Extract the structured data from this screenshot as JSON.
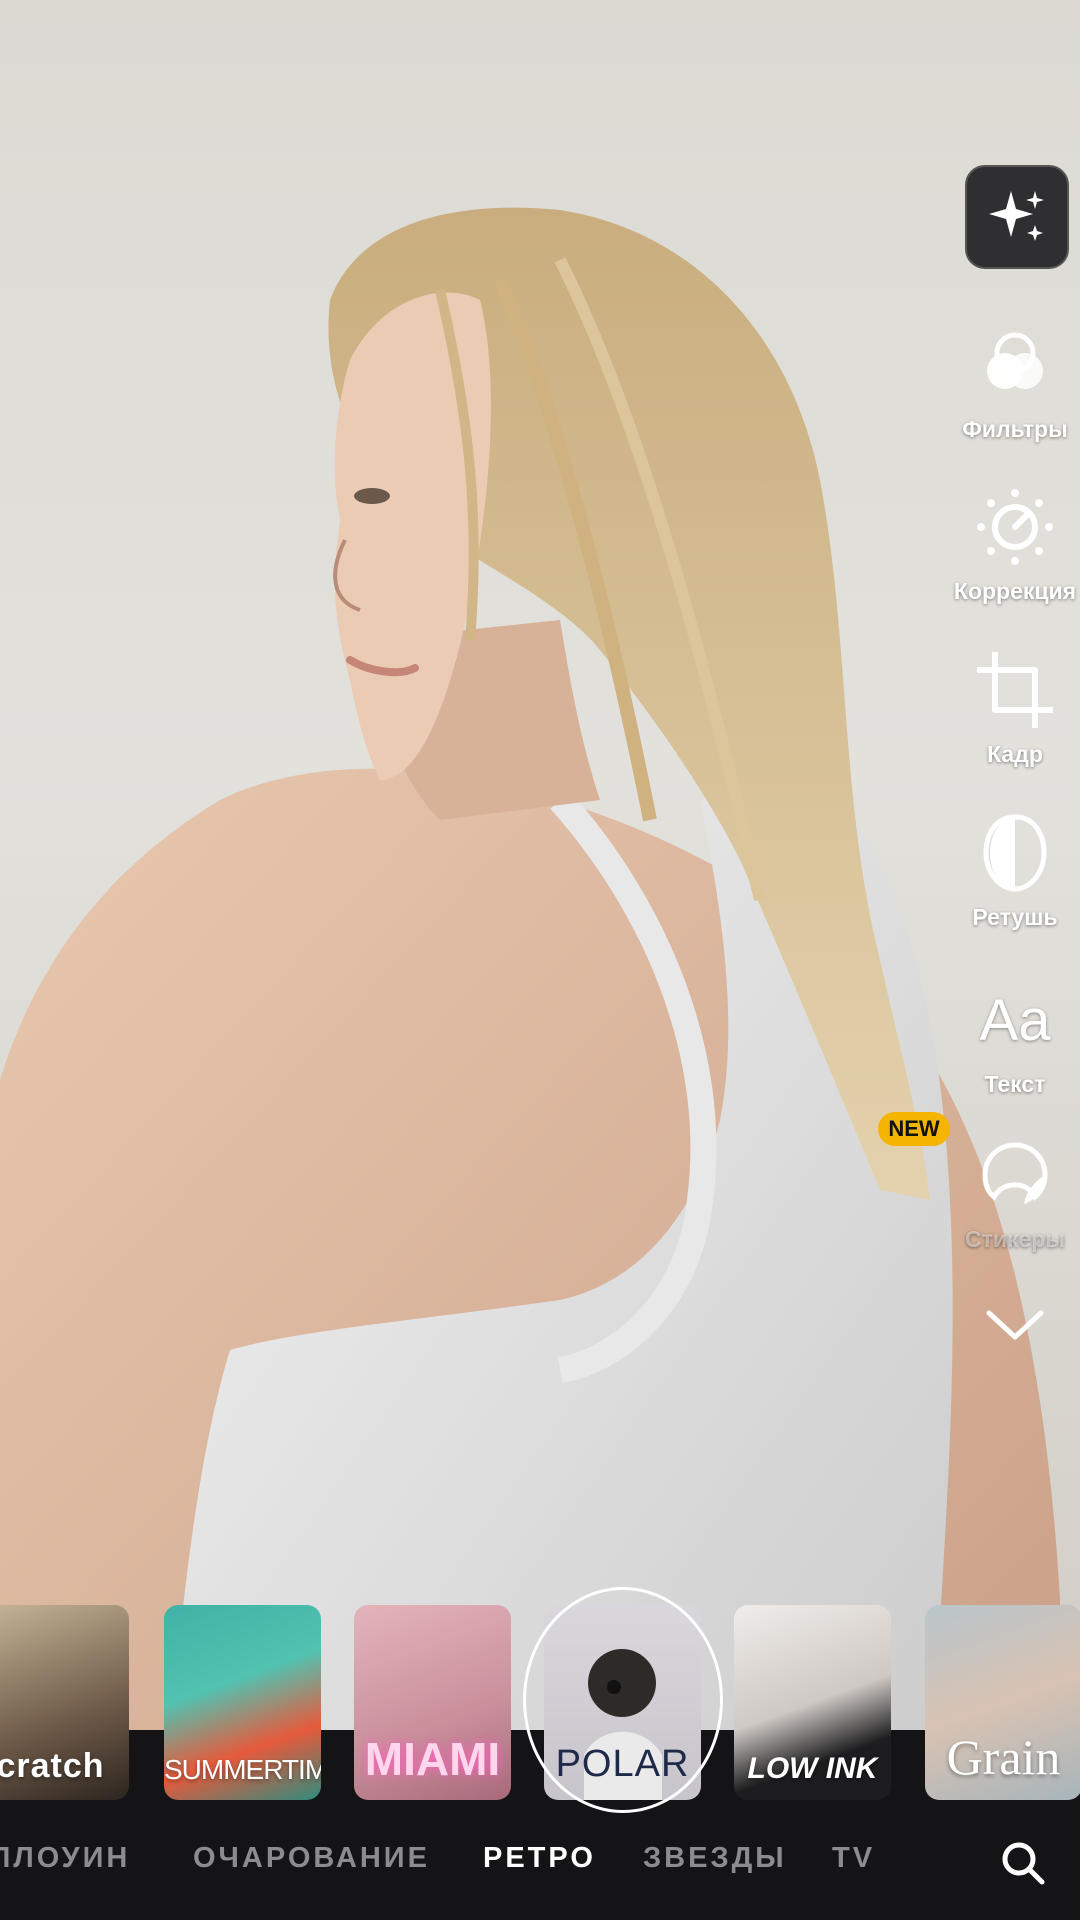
{
  "toolbar": {
    "ai_magic_icon": "sparkles-icon",
    "items": [
      {
        "label": "Фильтры",
        "icon": "filters-icon"
      },
      {
        "label": "Коррекция",
        "icon": "adjust-icon"
      },
      {
        "label": "Кадр",
        "icon": "crop-icon"
      },
      {
        "label": "Ретушь",
        "icon": "retouch-icon"
      },
      {
        "label": "Текст",
        "icon": "text-icon",
        "glyph": "Aa"
      },
      {
        "label": "Стикеры",
        "icon": "sticker-icon"
      }
    ],
    "new_badge": "NEW",
    "collapse_icon": "chevron-down-icon"
  },
  "filters": [
    {
      "label": "cratch"
    },
    {
      "label": "SUMMERTIME"
    },
    {
      "label": "MIAMI"
    },
    {
      "label": "POLAR",
      "selected": true
    },
    {
      "label": "LOW INK"
    },
    {
      "label": "Grain"
    }
  ],
  "categories": [
    "ЛЛОУИН",
    "ОЧАРОВАНИЕ",
    "РЕТРО",
    "ЗВЕЗДЫ",
    "TV"
  ],
  "active_category": "РЕТРО",
  "colors": {
    "accent_badge": "#f5b400",
    "panel_bg": "#141416"
  }
}
